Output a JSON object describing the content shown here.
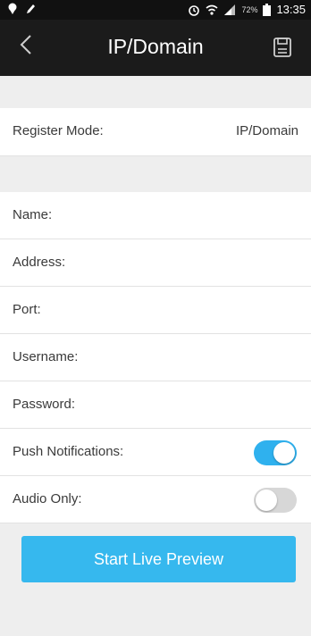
{
  "statusbar": {
    "battery_percent": "72%",
    "time": "13:35",
    "icons": [
      "notification-icon",
      "pen-icon",
      "alarm-icon",
      "wifi-icon",
      "signal-icon",
      "battery-icon"
    ]
  },
  "appbar": {
    "back_glyph": "<",
    "title": "IP/Domain",
    "save_icon": "save-icon"
  },
  "register": {
    "label": "Register Mode:",
    "value": "IP/Domain"
  },
  "fields": [
    {
      "label": "Name:",
      "value": ""
    },
    {
      "label": "Address:",
      "value": ""
    },
    {
      "label": "Port:",
      "value": ""
    },
    {
      "label": "Username:",
      "value": ""
    },
    {
      "label": "Password:",
      "value": ""
    }
  ],
  "toggles": [
    {
      "label": "Push Notifications:",
      "on": true
    },
    {
      "label": "Audio Only:",
      "on": false
    }
  ],
  "cta": {
    "label": "Start Live Preview"
  },
  "colors": {
    "accent": "#36b8ee",
    "toggle_on": "#2fb1ee",
    "toggle_off": "#d7d7d7",
    "appbar": "#1b1b1b",
    "background_band": "#eeeeee"
  }
}
